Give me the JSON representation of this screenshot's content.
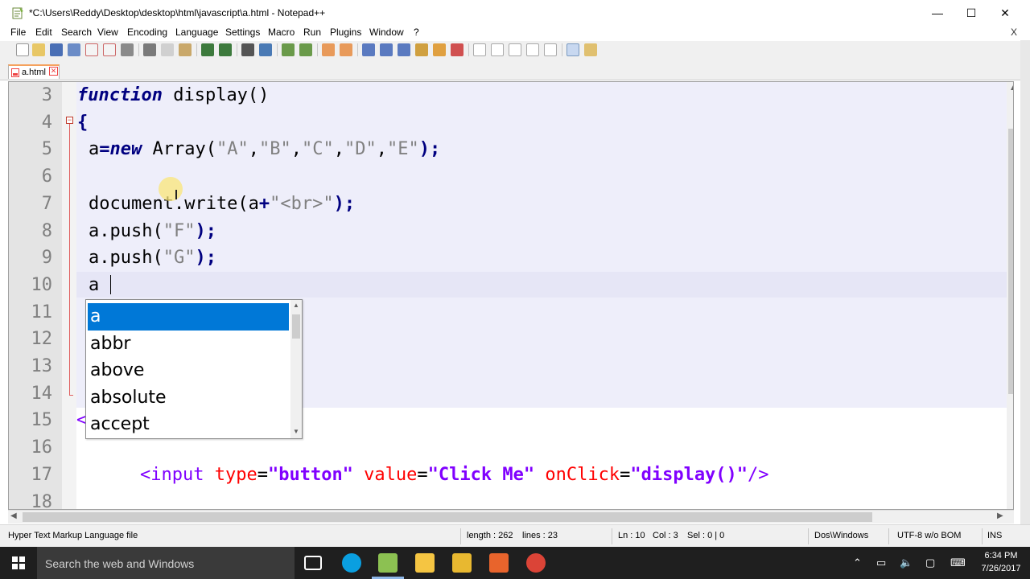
{
  "window": {
    "title": "*C:\\Users\\Reddy\\Desktop\\desktop\\html\\javascript\\a.html - Notepad++",
    "minimize": "—",
    "maximize": "☐",
    "close": "✕"
  },
  "menu": {
    "items": [
      "File",
      "Edit",
      "Search",
      "View",
      "Encoding",
      "Language",
      "Settings",
      "Macro",
      "Run",
      "Plugins",
      "Window",
      "?"
    ],
    "close_doc": "X"
  },
  "tab": {
    "label": "a.html",
    "close": "✕"
  },
  "editor": {
    "lines": [
      {
        "num": "3"
      },
      {
        "num": "4"
      },
      {
        "num": "5"
      },
      {
        "num": "6"
      },
      {
        "num": "7"
      },
      {
        "num": "8"
      },
      {
        "num": "9"
      },
      {
        "num": "10"
      },
      {
        "num": "11"
      },
      {
        "num": "12"
      },
      {
        "num": "13"
      },
      {
        "num": "14"
      },
      {
        "num": "15"
      },
      {
        "num": "16"
      },
      {
        "num": "17"
      },
      {
        "num": "18"
      }
    ],
    "code": {
      "l3_kw": "function",
      "l3_rest": " display()",
      "l4": "{",
      "l5_a": "a",
      "l5_eq": "=",
      "l5_new": "new",
      "l5_arr": " Array(",
      "l5_s1": "\"A\"",
      "l5_c1": ",",
      "l5_s2": "\"B\"",
      "l5_c2": ",",
      "l5_s3": "\"C\"",
      "l5_c3": ",",
      "l5_s4": "\"D\"",
      "l5_c4": ",",
      "l5_s5": "\"E\"",
      "l5_end": ");",
      "l7_a": "document.write(a",
      "l7_plus": "+",
      "l7_s": "\"<br>\"",
      "l7_end": ");",
      "l8_a": "a.push(",
      "l8_s": "\"F\"",
      "l8_end": ");",
      "l9_a": "a.push(",
      "l9_s": "\"G\"",
      "l9_end": ");",
      "l10": "a",
      "l15": "<",
      "l17_tag": "<input",
      "l17_attr1": " type",
      "l17_eq1": "=",
      "l17_v1": "\"button\"",
      "l17_attr2": " value",
      "l17_eq2": "=",
      "l17_v2": "\"Click Me\"",
      "l17_attr3": " onClick",
      "l17_eq3": "=",
      "l17_v3": "\"display()\"",
      "l17_close": "/>"
    }
  },
  "autocomplete": {
    "items": [
      "a",
      "abbr",
      "above",
      "absolute",
      "accept"
    ],
    "selected": "a"
  },
  "status": {
    "file_type": "Hyper Text Markup Language file",
    "length": "length : 262",
    "lines": "lines : 23",
    "ln": "Ln : 10",
    "col": "Col : 3",
    "sel": "Sel : 0 | 0",
    "eol": "Dos\\Windows",
    "encoding": "UTF-8 w/o BOM",
    "mode": "INS"
  },
  "taskbar": {
    "search_placeholder": "Search the web and Windows",
    "time": "6:34 PM",
    "date": "7/26/2017"
  }
}
